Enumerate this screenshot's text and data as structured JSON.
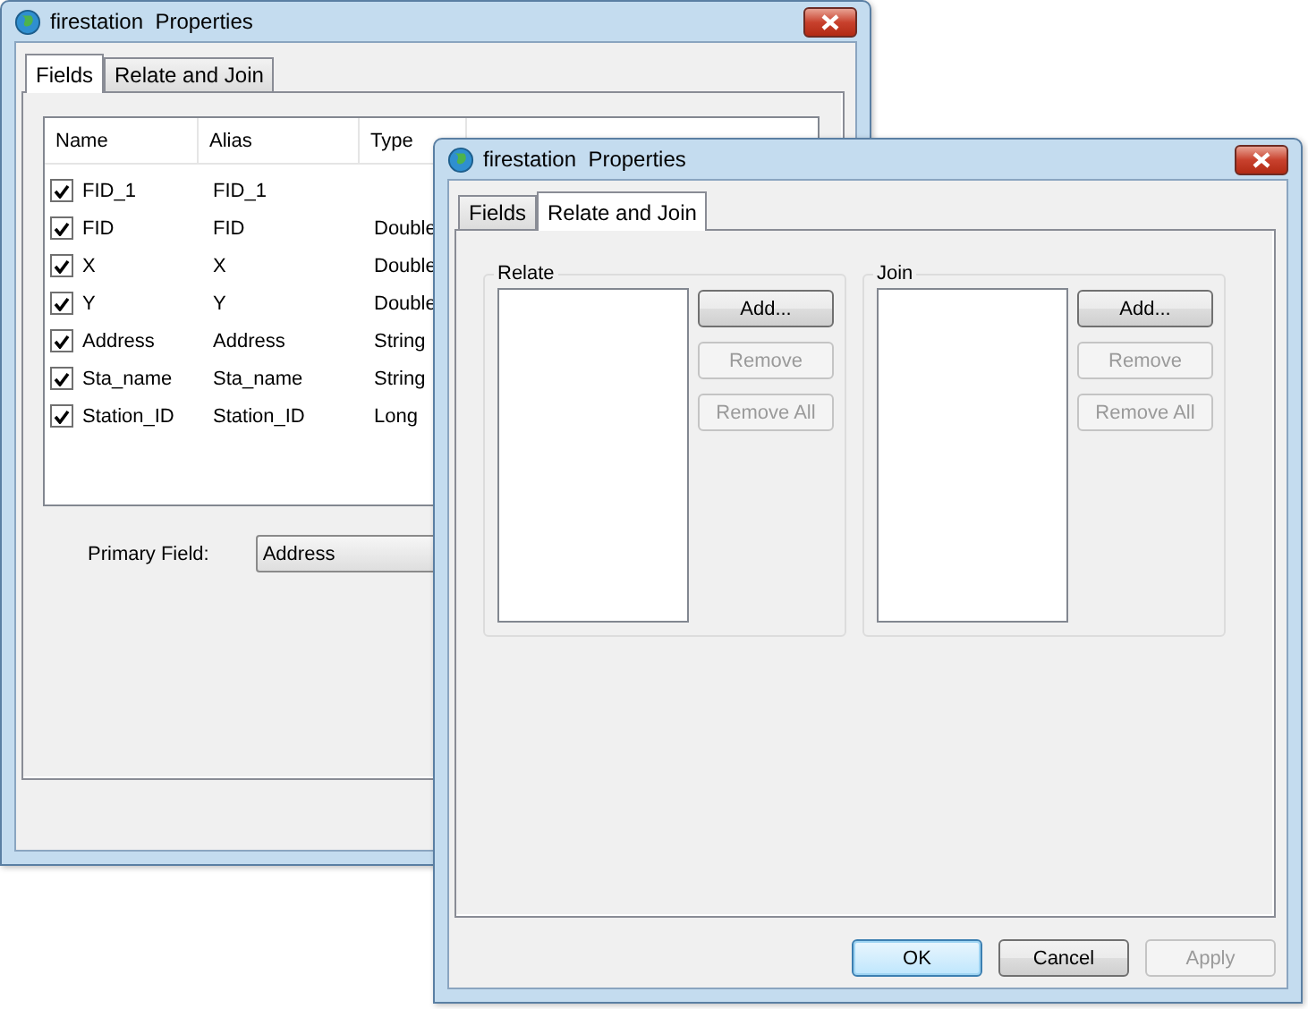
{
  "back_window": {
    "title": "firestation  Properties",
    "tabs": [
      {
        "label": "Fields",
        "selected": true
      },
      {
        "label": "Relate and Join",
        "selected": false
      }
    ],
    "table": {
      "columns": [
        "Name",
        "Alias",
        "Type"
      ],
      "rows": [
        {
          "name": "FID_1",
          "alias": "FID_1",
          "checked": true
        },
        {
          "name": "FID",
          "alias": "FID",
          "type": "Double",
          "checked": true
        },
        {
          "name": "X",
          "alias": "X",
          "type": "Double",
          "checked": true
        },
        {
          "name": "Y",
          "alias": "Y",
          "type": "Double",
          "checked": true
        },
        {
          "name": "Address",
          "alias": "Address",
          "type": "String",
          "checked": true
        },
        {
          "name": "Sta_name",
          "alias": "Sta_name",
          "type": "String",
          "checked": true
        },
        {
          "name": "Station_ID",
          "alias": "Station_ID",
          "type": "Long",
          "checked": true
        }
      ]
    },
    "primary_field": {
      "label": "Primary Field:",
      "value": "Address"
    }
  },
  "front_window": {
    "title": "firestation  Properties",
    "tabs": [
      {
        "label": "Fields",
        "selected": false
      },
      {
        "label": "Relate and Join",
        "selected": true
      }
    ],
    "groups": [
      {
        "label": "Relate",
        "buttons": [
          {
            "label": "Add...",
            "disabled": false
          },
          {
            "label": "Remove",
            "disabled": true
          },
          {
            "label": "Remove All",
            "disabled": true
          }
        ]
      },
      {
        "label": "Join",
        "buttons": [
          {
            "label": "Add...",
            "disabled": false
          },
          {
            "label": "Remove",
            "disabled": true
          },
          {
            "label": "Remove All",
            "disabled": true
          }
        ]
      }
    ],
    "buttons": [
      {
        "label": "OK",
        "disabled": false,
        "default": true
      },
      {
        "label": "Cancel",
        "disabled": false,
        "default": false
      },
      {
        "label": "Apply",
        "disabled": true,
        "default": false
      }
    ]
  }
}
